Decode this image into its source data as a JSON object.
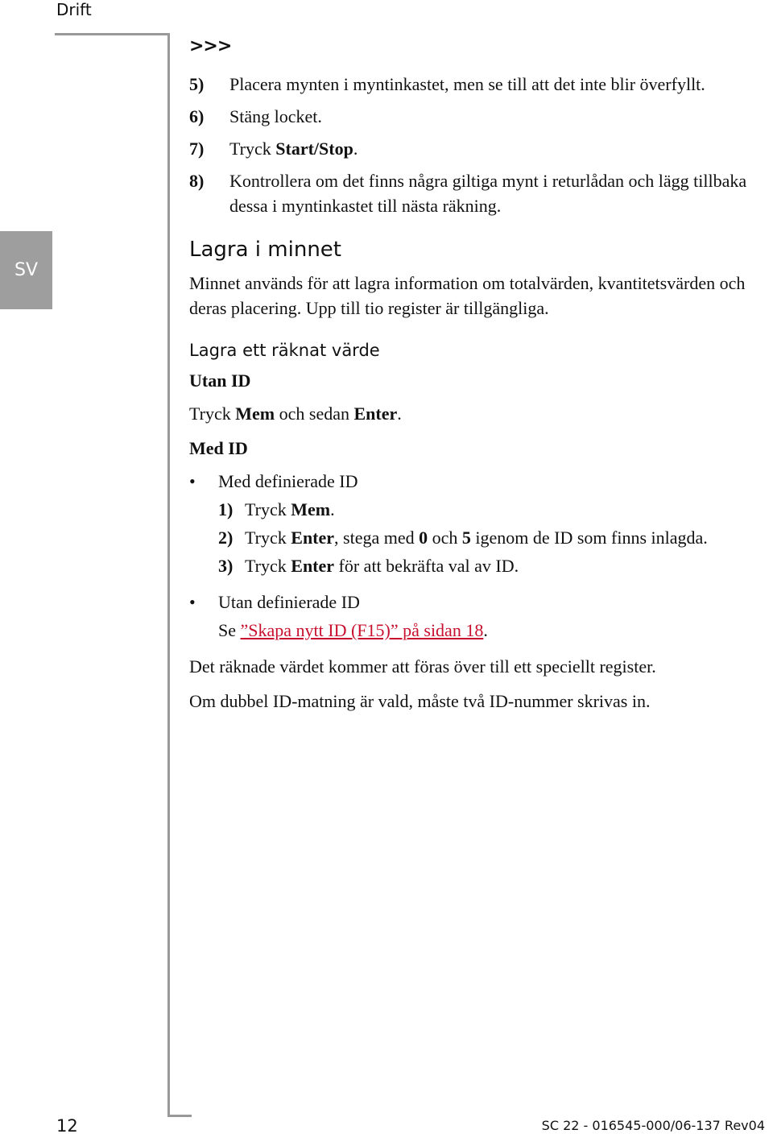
{
  "header": {
    "section_title": "Drift"
  },
  "sidebar": {
    "language_tab": "SV"
  },
  "continuation_mark": ">>>",
  "steps": [
    {
      "num": "5)",
      "text": "Placera mynten i myntinkastet, men se till att det inte blir överfyllt."
    },
    {
      "num": "6)",
      "text": "Stäng locket."
    },
    {
      "num": "7)",
      "pre": "Tryck ",
      "bold": "Start/Stop",
      "post": "."
    },
    {
      "num": "8)",
      "text": "Kontrollera om det finns några giltiga mynt i returlådan och lägg tillbaka dessa i myntinkastet till nästa räkning."
    }
  ],
  "section": {
    "title": "Lagra i minnet",
    "intro": "Minnet används för att lagra information om totalvärden, kvantitetsvärden och deras placering. Upp till tio register är tillgängliga.",
    "subsection_title": "Lagra ett räknat värde",
    "without_id": {
      "heading": "Utan ID",
      "pre": "Tryck ",
      "b1": "Mem",
      "mid": " och sedan ",
      "b2": "Enter",
      "post": "."
    },
    "with_id": {
      "heading": "Med ID",
      "bullet1": "Med definierade ID",
      "substeps": [
        {
          "num": "1)",
          "pre": "Tryck ",
          "bold": "Mem",
          "post": "."
        },
        {
          "num": "2)",
          "pre": "Tryck ",
          "bold": "Enter",
          "mid": ", stega med ",
          "b2": "0",
          "mid2": " och ",
          "b3": "5",
          "post": " igenom de ID som finns inlagda."
        },
        {
          "num": "3)",
          "pre": "Tryck ",
          "bold": "Enter",
          "post": " för att bekräfta val av ID."
        }
      ],
      "bullet2": "Utan definierade ID",
      "see_pre": "Se ",
      "see_link": "”Skapa nytt ID (F15)” på sidan 18",
      "see_post": "."
    },
    "note1": "Det räknade värdet kommer att föras över till ett speciellt register.",
    "note2": "Om dubbel ID-matning är vald, måste två ID-nummer skrivas in."
  },
  "footer": {
    "page_number": "12",
    "doc_id": "SC 22 - 016545-000/06-137 Rev04"
  },
  "colors": {
    "frame": "#999999",
    "tab": "#9e9e9e",
    "link": "#c8102e"
  }
}
